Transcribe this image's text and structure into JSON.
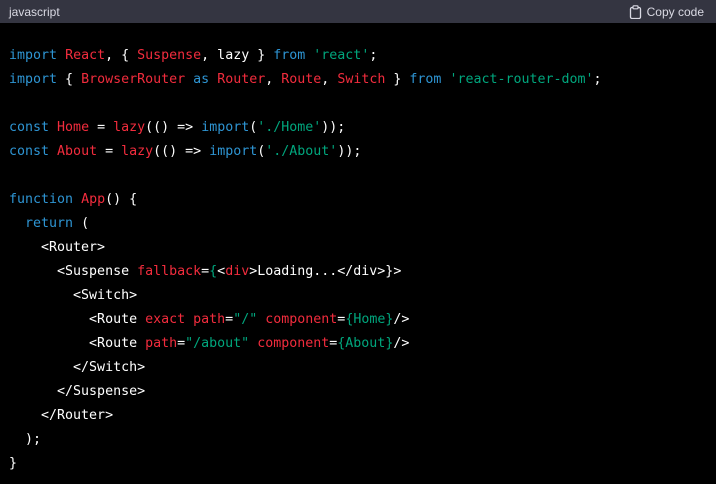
{
  "header": {
    "language": "javascript",
    "copy_label": "Copy code"
  },
  "colors": {
    "keyword": "#2e95d3",
    "identifier": "#f22c3d",
    "string": "#00a67d",
    "plain": "#ffffff",
    "header_bg": "#343541",
    "code_bg": "#000000"
  },
  "code_lines": [
    [
      {
        "t": "import",
        "c": "kw"
      },
      {
        "t": " ",
        "c": "plain"
      },
      {
        "t": "React",
        "c": "id"
      },
      {
        "t": ", { ",
        "c": "plain"
      },
      {
        "t": "Suspense",
        "c": "id"
      },
      {
        "t": ", lazy } ",
        "c": "plain"
      },
      {
        "t": "from",
        "c": "kw"
      },
      {
        "t": " ",
        "c": "plain"
      },
      {
        "t": "'react'",
        "c": "str"
      },
      {
        "t": ";",
        "c": "plain"
      }
    ],
    [
      {
        "t": "import",
        "c": "kw"
      },
      {
        "t": " { ",
        "c": "plain"
      },
      {
        "t": "BrowserRouter",
        "c": "id"
      },
      {
        "t": " ",
        "c": "plain"
      },
      {
        "t": "as",
        "c": "kw"
      },
      {
        "t": " ",
        "c": "plain"
      },
      {
        "t": "Router",
        "c": "id"
      },
      {
        "t": ", ",
        "c": "plain"
      },
      {
        "t": "Route",
        "c": "id"
      },
      {
        "t": ", ",
        "c": "plain"
      },
      {
        "t": "Switch",
        "c": "id"
      },
      {
        "t": " } ",
        "c": "plain"
      },
      {
        "t": "from",
        "c": "kw"
      },
      {
        "t": " ",
        "c": "plain"
      },
      {
        "t": "'react-router-dom'",
        "c": "str"
      },
      {
        "t": ";",
        "c": "plain"
      }
    ],
    [],
    [
      {
        "t": "const",
        "c": "kw"
      },
      {
        "t": " ",
        "c": "plain"
      },
      {
        "t": "Home",
        "c": "id"
      },
      {
        "t": " = ",
        "c": "plain"
      },
      {
        "t": "lazy",
        "c": "id"
      },
      {
        "t": "(() => ",
        "c": "plain"
      },
      {
        "t": "import",
        "c": "kw"
      },
      {
        "t": "(",
        "c": "plain"
      },
      {
        "t": "'./Home'",
        "c": "str"
      },
      {
        "t": "));",
        "c": "plain"
      }
    ],
    [
      {
        "t": "const",
        "c": "kw"
      },
      {
        "t": " ",
        "c": "plain"
      },
      {
        "t": "About",
        "c": "id"
      },
      {
        "t": " = ",
        "c": "plain"
      },
      {
        "t": "lazy",
        "c": "id"
      },
      {
        "t": "(() => ",
        "c": "plain"
      },
      {
        "t": "import",
        "c": "kw"
      },
      {
        "t": "(",
        "c": "plain"
      },
      {
        "t": "'./About'",
        "c": "str"
      },
      {
        "t": "));",
        "c": "plain"
      }
    ],
    [],
    [
      {
        "t": "function",
        "c": "kw"
      },
      {
        "t": " ",
        "c": "plain"
      },
      {
        "t": "App",
        "c": "id"
      },
      {
        "t": "() {",
        "c": "plain"
      }
    ],
    [
      {
        "t": "  ",
        "c": "plain"
      },
      {
        "t": "return",
        "c": "kw"
      },
      {
        "t": " (",
        "c": "plain"
      }
    ],
    [
      {
        "t": "    <Router>",
        "c": "plain"
      }
    ],
    [
      {
        "t": "      <Suspense ",
        "c": "plain"
      },
      {
        "t": "fallback",
        "c": "id"
      },
      {
        "t": "=",
        "c": "plain"
      },
      {
        "t": "{",
        "c": "str"
      },
      {
        "t": "<",
        "c": "plain"
      },
      {
        "t": "div",
        "c": "id"
      },
      {
        "t": ">Loading...</div>}>",
        "c": "plain"
      }
    ],
    [
      {
        "t": "        <Switch>",
        "c": "plain"
      }
    ],
    [
      {
        "t": "          <Route ",
        "c": "plain"
      },
      {
        "t": "exact",
        "c": "id"
      },
      {
        "t": " ",
        "c": "plain"
      },
      {
        "t": "path",
        "c": "id"
      },
      {
        "t": "=",
        "c": "plain"
      },
      {
        "t": "\"/\"",
        "c": "str"
      },
      {
        "t": " ",
        "c": "plain"
      },
      {
        "t": "component",
        "c": "id"
      },
      {
        "t": "=",
        "c": "plain"
      },
      {
        "t": "{Home}",
        "c": "str"
      },
      {
        "t": "/>",
        "c": "plain"
      }
    ],
    [
      {
        "t": "          <Route ",
        "c": "plain"
      },
      {
        "t": "path",
        "c": "id"
      },
      {
        "t": "=",
        "c": "plain"
      },
      {
        "t": "\"/about\"",
        "c": "str"
      },
      {
        "t": " ",
        "c": "plain"
      },
      {
        "t": "component",
        "c": "id"
      },
      {
        "t": "=",
        "c": "plain"
      },
      {
        "t": "{About}",
        "c": "str"
      },
      {
        "t": "/>",
        "c": "plain"
      }
    ],
    [
      {
        "t": "        </Switch>",
        "c": "plain"
      }
    ],
    [
      {
        "t": "      </Suspense>",
        "c": "plain"
      }
    ],
    [
      {
        "t": "    </Router>",
        "c": "plain"
      }
    ],
    [
      {
        "t": "  );",
        "c": "plain"
      }
    ],
    [
      {
        "t": "}",
        "c": "plain"
      }
    ]
  ]
}
